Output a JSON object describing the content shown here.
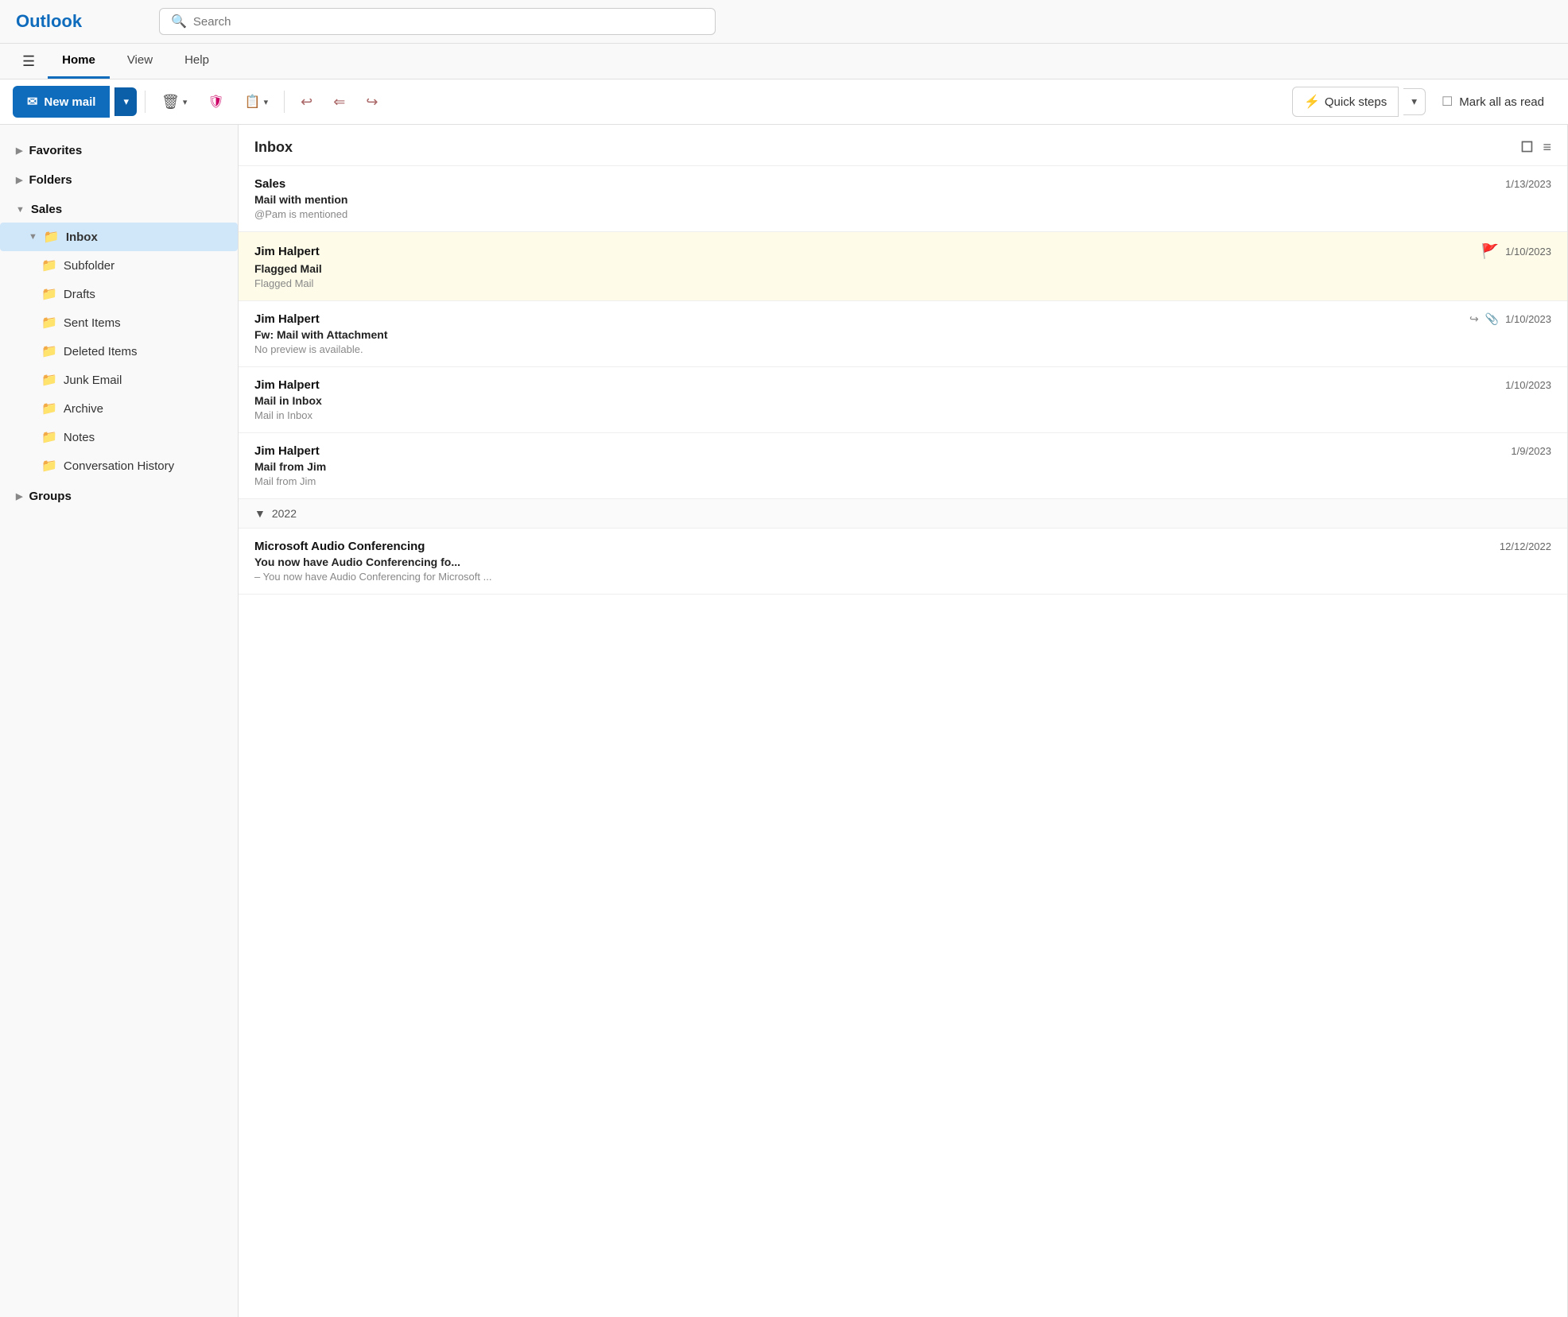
{
  "app": {
    "logo": "Outlook"
  },
  "search": {
    "placeholder": "Search"
  },
  "nav": {
    "tabs": [
      {
        "id": "home",
        "label": "Home",
        "active": true
      },
      {
        "id": "view",
        "label": "View",
        "active": false
      },
      {
        "id": "help",
        "label": "Help",
        "active": false
      }
    ]
  },
  "toolbar": {
    "new_mail_label": "New mail",
    "delete_icon": "🗑",
    "shield_icon": "🛡",
    "move_icon": "📋",
    "reply_icon": "↩",
    "reply_all_icon": "↩↩",
    "forward_icon": "↪",
    "quick_steps_label": "Quick steps",
    "mark_all_label": "Mark all as read"
  },
  "sidebar": {
    "favorites_label": "Favorites",
    "folders_label": "Folders",
    "sales_label": "Sales",
    "inbox_label": "Inbox",
    "subfolder_label": "Subfolder",
    "drafts_label": "Drafts",
    "sent_items_label": "Sent Items",
    "deleted_items_label": "Deleted Items",
    "junk_email_label": "Junk Email",
    "archive_label": "Archive",
    "notes_label": "Notes",
    "conversation_history_label": "Conversation History",
    "groups_label": "Groups"
  },
  "inbox": {
    "title": "Inbox",
    "emails": [
      {
        "id": 1,
        "sender": "Sales",
        "subject": "Mail with mention",
        "preview": "@Pam is mentioned",
        "date": "1/13/2023",
        "flagged": false,
        "has_forward": false,
        "has_attachment": false,
        "year_group": null
      },
      {
        "id": 2,
        "sender": "Jim Halpert",
        "subject": "Flagged Mail",
        "preview": "Flagged Mail",
        "date": "1/10/2023",
        "flagged": true,
        "has_forward": false,
        "has_attachment": false,
        "year_group": null
      },
      {
        "id": 3,
        "sender": "Jim Halpert",
        "subject": "Fw: Mail with Attachment",
        "preview": "No preview is available.",
        "date": "1/10/2023",
        "flagged": false,
        "has_forward": true,
        "has_attachment": true,
        "year_group": null
      },
      {
        "id": 4,
        "sender": "Jim Halpert",
        "subject": "Mail in Inbox",
        "preview": "Mail in Inbox",
        "date": "1/10/2023",
        "flagged": false,
        "has_forward": false,
        "has_attachment": false,
        "year_group": null
      },
      {
        "id": 5,
        "sender": "Jim Halpert",
        "subject": "Mail from Jim",
        "preview": "Mail from Jim",
        "date": "1/9/2023",
        "flagged": false,
        "has_forward": false,
        "has_attachment": false,
        "year_group": null
      },
      {
        "id": 6,
        "sender": "Microsoft Audio Conferencing",
        "subject": "You now have Audio Conferencing fo...",
        "preview": "– You now have Audio Conferencing for Microsoft ...",
        "date": "12/12/2022",
        "flagged": false,
        "has_forward": false,
        "has_attachment": false,
        "year_group": "2022"
      }
    ]
  }
}
